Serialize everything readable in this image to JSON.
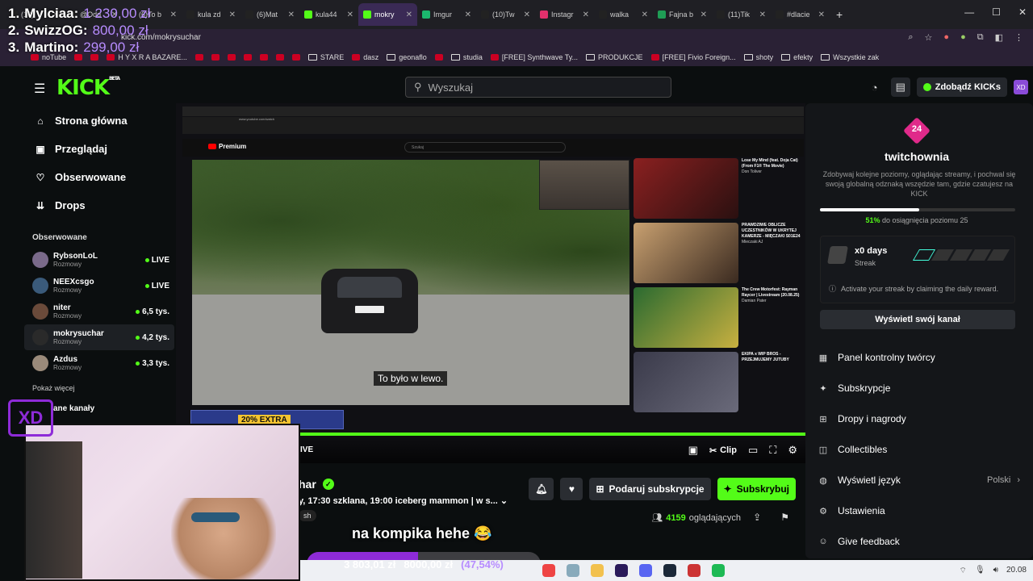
{
  "donors": [
    {
      "rank": "1.",
      "name": "Mylciaa:",
      "amount": "1 230,00 zł"
    },
    {
      "rank": "2.",
      "name": "SwizzOG:",
      "amount": "800,00 zł"
    },
    {
      "rank": "3.",
      "name": "Martino:",
      "amount": "299,00 zł"
    }
  ],
  "browser": {
    "tabs": [
      "(16) ",
      "@Odd",
      "(6)To b",
      "kula zd",
      "(6)Mat",
      "kula44",
      "mokry",
      "Imgur",
      "(10)Tw",
      "Instagr",
      "walka",
      "Fajna b",
      "(11)Tik",
      "#dlacie"
    ],
    "url": "kick.com/mokrysuchar",
    "bookmarks": [
      "noTube",
      "",
      "",
      "H Y X R A BAZARE...",
      "",
      "",
      "",
      "",
      "",
      "",
      "",
      "STARE",
      "dasz",
      "geonaflo",
      "",
      "studia",
      "[FREE] Synthwave Ty...",
      "PRODUKCJE",
      "[FREE] Fivio Foreign...",
      "shoty",
      "efekty",
      "Wszystkie zak"
    ]
  },
  "kick": {
    "logo": "KICK",
    "logo_sup": "BETA",
    "search_placeholder": "Wyszukaj",
    "kicks_button": "Zdobądź KICKs",
    "nav": [
      {
        "label": "Strona główna",
        "icon": "home-icon"
      },
      {
        "label": "Przeglądaj",
        "icon": "browse-icon"
      },
      {
        "label": "Obserwowane",
        "icon": "heart-icon"
      },
      {
        "label": "Drops",
        "icon": "drops-icon"
      }
    ],
    "followed_title": "Obserwowane",
    "channels": [
      {
        "name": "RybsonLoL",
        "category": "Rozmowy",
        "stat": "LIVE"
      },
      {
        "name": "NEEXcsgo",
        "category": "Rozmowy",
        "stat": "LIVE"
      },
      {
        "name": "niter",
        "category": "Rozmowy",
        "stat": "6,5 tys."
      },
      {
        "name": "mokrysuchar",
        "category": "Rozmowy",
        "stat": "4,2 tys."
      },
      {
        "name": "Azdus",
        "category": "Rozmowy",
        "stat": "3,3 tys."
      }
    ],
    "show_more": "Pokaż więcej",
    "recommended_title": "ane kanały"
  },
  "video": {
    "subtitle": "To było w lewo.",
    "extra_label": "20% EXTRA",
    "live_label": "IVE",
    "clip_label": "Clip",
    "yt_logo": "Premium",
    "yt_search": "Szukaj",
    "thumbs": [
      {
        "title": "Lose My Mind (feat. Doja Cat) (From F1® The Movie)",
        "meta": "Don Toliver",
        "time": "3:30"
      },
      {
        "title": "PRAWDZIWE OBLICZE UCZESTNIKÓW W UKRYTEJ KAMERZE - MIĘCZAKI S01E24",
        "meta": "Mieczaki AJ",
        "time": "1:02:32"
      },
      {
        "title": "The Crew Motorfest: Rayman Raycer | Livestream (20.08.25)",
        "meta": "Damian Pater",
        "time": "27:12"
      },
      {
        "title": "EKIPA x WIP BROS - PRZEJMUJEMY JUTUBY",
        "meta": "",
        "time": ""
      }
    ]
  },
  "stream": {
    "streamer": "har",
    "title": "y, 17:30 szklana, 19:00 iceberg mammon | w s...",
    "tag": "sh",
    "gift_button": "Podaruj subskrypcje",
    "subscribe_button": "Subskrybuj",
    "viewers_count": "4159",
    "viewers_label": "oglądających",
    "overlay_message": "na kompika hehe 😂",
    "goal_current": "3 803,01 zł",
    "goal_target": "8000,00 zł",
    "goal_percent_label": "(47,54%)",
    "goal_fraction": 0.4754
  },
  "panel": {
    "level_badge": "24",
    "username": "twitchownia",
    "description": "Zdobywaj kolejne poziomy, oglądając streamy, i pochwal się swoją globalną odznaką wszędzie tam, gdzie czatujesz na KICK",
    "progress_fraction": 0.51,
    "progress_percent": "51%",
    "progress_text": "do osiągnięcia poziomu 25",
    "streak_days": "x0 days",
    "streak_label": "Streak",
    "streak_info": "Activate your streak by claiming the daily reward.",
    "channel_button": "Wyświetl swój kanał",
    "menu": [
      {
        "label": "Panel kontrolny twórcy",
        "icon": "dashboard-icon"
      },
      {
        "label": "Subskrypcje",
        "icon": "sparkle-icon"
      },
      {
        "label": "Dropy i nagrody",
        "icon": "gift-icon"
      },
      {
        "label": "Collectibles",
        "icon": "collectibles-icon"
      },
      {
        "label": "Wyświetl język",
        "icon": "globe-icon",
        "value": "Polski"
      },
      {
        "label": "Ustawienia",
        "icon": "gear-icon"
      },
      {
        "label": "Give feedback",
        "icon": "feedback-icon"
      }
    ]
  },
  "overlay_logo": "XD",
  "clock": "20.08"
}
